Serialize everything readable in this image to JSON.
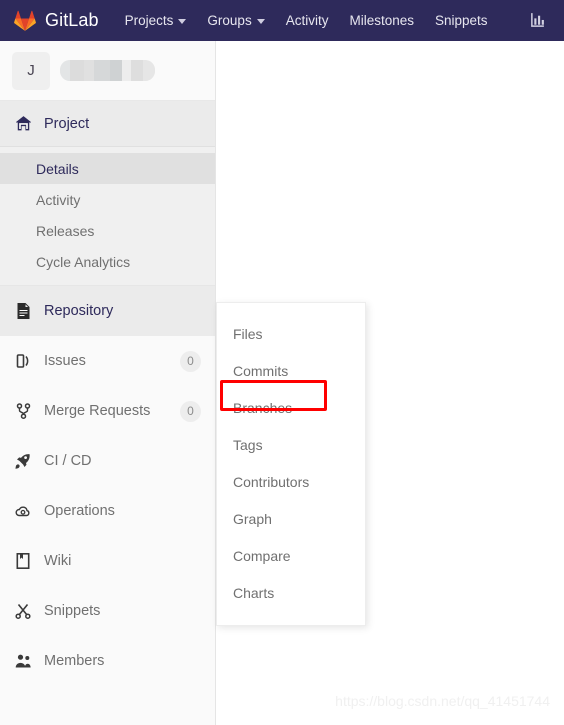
{
  "navbar": {
    "brand_label": "GitLab",
    "brand_icon": "gitlab-tanuki-logo",
    "background_color": "#2e2a5b",
    "links": [
      {
        "label": "Projects",
        "has_caret": true
      },
      {
        "label": "Groups",
        "has_caret": true
      },
      {
        "label": "Activity",
        "has_caret": false
      },
      {
        "label": "Milestones",
        "has_caret": false
      },
      {
        "label": "Snippets",
        "has_caret": false
      }
    ],
    "analytics_icon": "bar-chart-icon"
  },
  "sidebar": {
    "user": {
      "avatar_initial": "J",
      "project_name_redacted": true
    },
    "project_section": {
      "label": "Project",
      "icon": "home-icon",
      "items": [
        {
          "label": "Details",
          "active": true
        },
        {
          "label": "Activity",
          "active": false
        },
        {
          "label": "Releases",
          "active": false
        },
        {
          "label": "Cycle Analytics",
          "active": false
        }
      ]
    },
    "items": [
      {
        "label": "Repository",
        "icon": "document-icon",
        "badge": "",
        "highlight": true
      },
      {
        "label": "Issues",
        "icon": "issues-icon",
        "badge": "0",
        "highlight": false
      },
      {
        "label": "Merge Requests",
        "icon": "merge-request-icon",
        "badge": "0",
        "highlight": false
      },
      {
        "label": "CI / CD",
        "icon": "rocket-icon",
        "badge": "",
        "highlight": false
      },
      {
        "label": "Operations",
        "icon": "cloud-gear-icon",
        "badge": "",
        "highlight": false
      },
      {
        "label": "Wiki",
        "icon": "book-icon",
        "badge": "",
        "highlight": false
      },
      {
        "label": "Snippets",
        "icon": "scissors-icon",
        "badge": "",
        "highlight": false
      },
      {
        "label": "Members",
        "icon": "users-icon",
        "badge": "",
        "highlight": false
      }
    ]
  },
  "flyout": {
    "items": [
      {
        "label": "Files",
        "highlighted": false
      },
      {
        "label": "Commits",
        "highlighted": false
      },
      {
        "label": "Branches",
        "highlighted": true
      },
      {
        "label": "Tags",
        "highlighted": false
      },
      {
        "label": "Contributors",
        "highlighted": false
      },
      {
        "label": "Graph",
        "highlighted": false
      },
      {
        "label": "Compare",
        "highlighted": false
      },
      {
        "label": "Charts",
        "highlighted": false
      }
    ],
    "annotation_color": "#ff0000"
  },
  "watermark": {
    "text": "https://blog.csdn.net/qq_41451744"
  }
}
